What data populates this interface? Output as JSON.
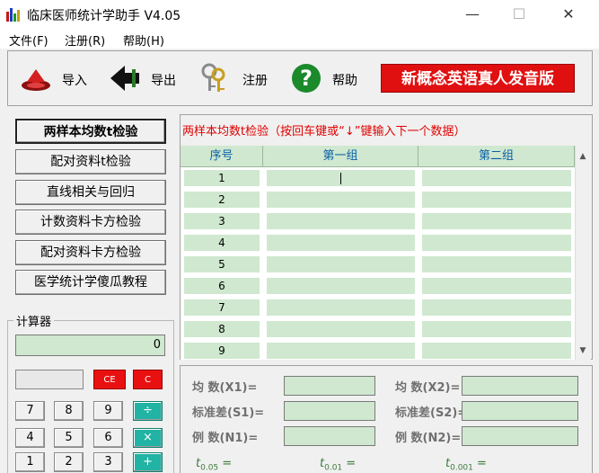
{
  "window": {
    "title": "临床医师统计学助手 V4.05",
    "minimize": "—",
    "maximize": "☐",
    "close": "✕"
  },
  "menu": [
    "文件(F)",
    "注册(R)",
    "帮助(H)"
  ],
  "toolbar": {
    "import": "导入",
    "export": "导出",
    "register": "注册",
    "help": "帮助",
    "help_glyph": "?",
    "banner": "新概念英语真人发音版"
  },
  "left_buttons": [
    "两样本均数t检验",
    "配对资料t检验",
    "直线相关与回归",
    "计数资料卡方检验",
    "配对资料卡方检验",
    "医学统计学傻瓜教程"
  ],
  "calculator": {
    "label": "计算器",
    "display": "0",
    "red_buttons": [
      "CE",
      "C"
    ],
    "rows": [
      [
        "7",
        "8",
        "9",
        "÷"
      ],
      [
        "4",
        "5",
        "6",
        "×"
      ],
      [
        "1",
        "2",
        "3",
        "+"
      ]
    ]
  },
  "grid": {
    "header_text": "两样本均数t检验（按回车键或“↓”键输入下一个数据）",
    "columns": [
      "序号",
      "第一组",
      "第二组"
    ],
    "rows": [
      "1",
      "2",
      "3",
      "4",
      "5",
      "6",
      "7",
      "8",
      "9"
    ]
  },
  "stats": {
    "mean1": "均  数(X1)=",
    "mean2": "均  数(X2)=",
    "sd1": "标准差(S1)=",
    "sd2": "标准差(S2)=",
    "n1": "例  数(N1)=",
    "n2": "例  数(N2)=",
    "t_letter": "t",
    "t005": "0.05",
    "t001": "0.01",
    "t0001": "0.001",
    "eq": "="
  },
  "colors": {
    "green_cell": "#cfe8cf",
    "banner_red": "#e01010",
    "operator_teal": "#21b3a3"
  }
}
